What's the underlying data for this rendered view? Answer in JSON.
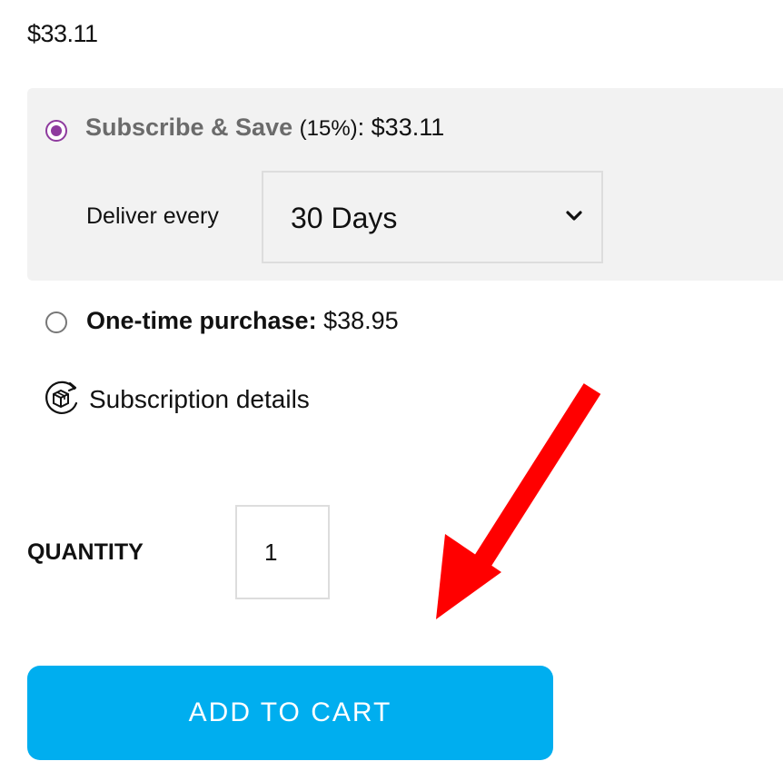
{
  "price": "$33.11",
  "subscription": {
    "title": "Subscribe & Save",
    "discount": "(15%)",
    "price_text": ": $33.11",
    "selected": true,
    "deliver_label": "Deliver every",
    "frequency_value": "30 Days"
  },
  "one_time": {
    "title": "One-time purchase:",
    "price": "$38.95",
    "selected": false
  },
  "details": {
    "label": "Subscription details",
    "icon": "subscription-box-icon"
  },
  "quantity": {
    "label": "QUANTITY",
    "value": "1"
  },
  "add_to_cart": {
    "label": "ADD TO CART"
  },
  "annotation": {
    "icon": "red-arrow-icon"
  },
  "colors": {
    "accent": "#8e3a9e",
    "button": "#00aeef",
    "annotation": "#ff0000",
    "panel": "#f2f2f2"
  }
}
